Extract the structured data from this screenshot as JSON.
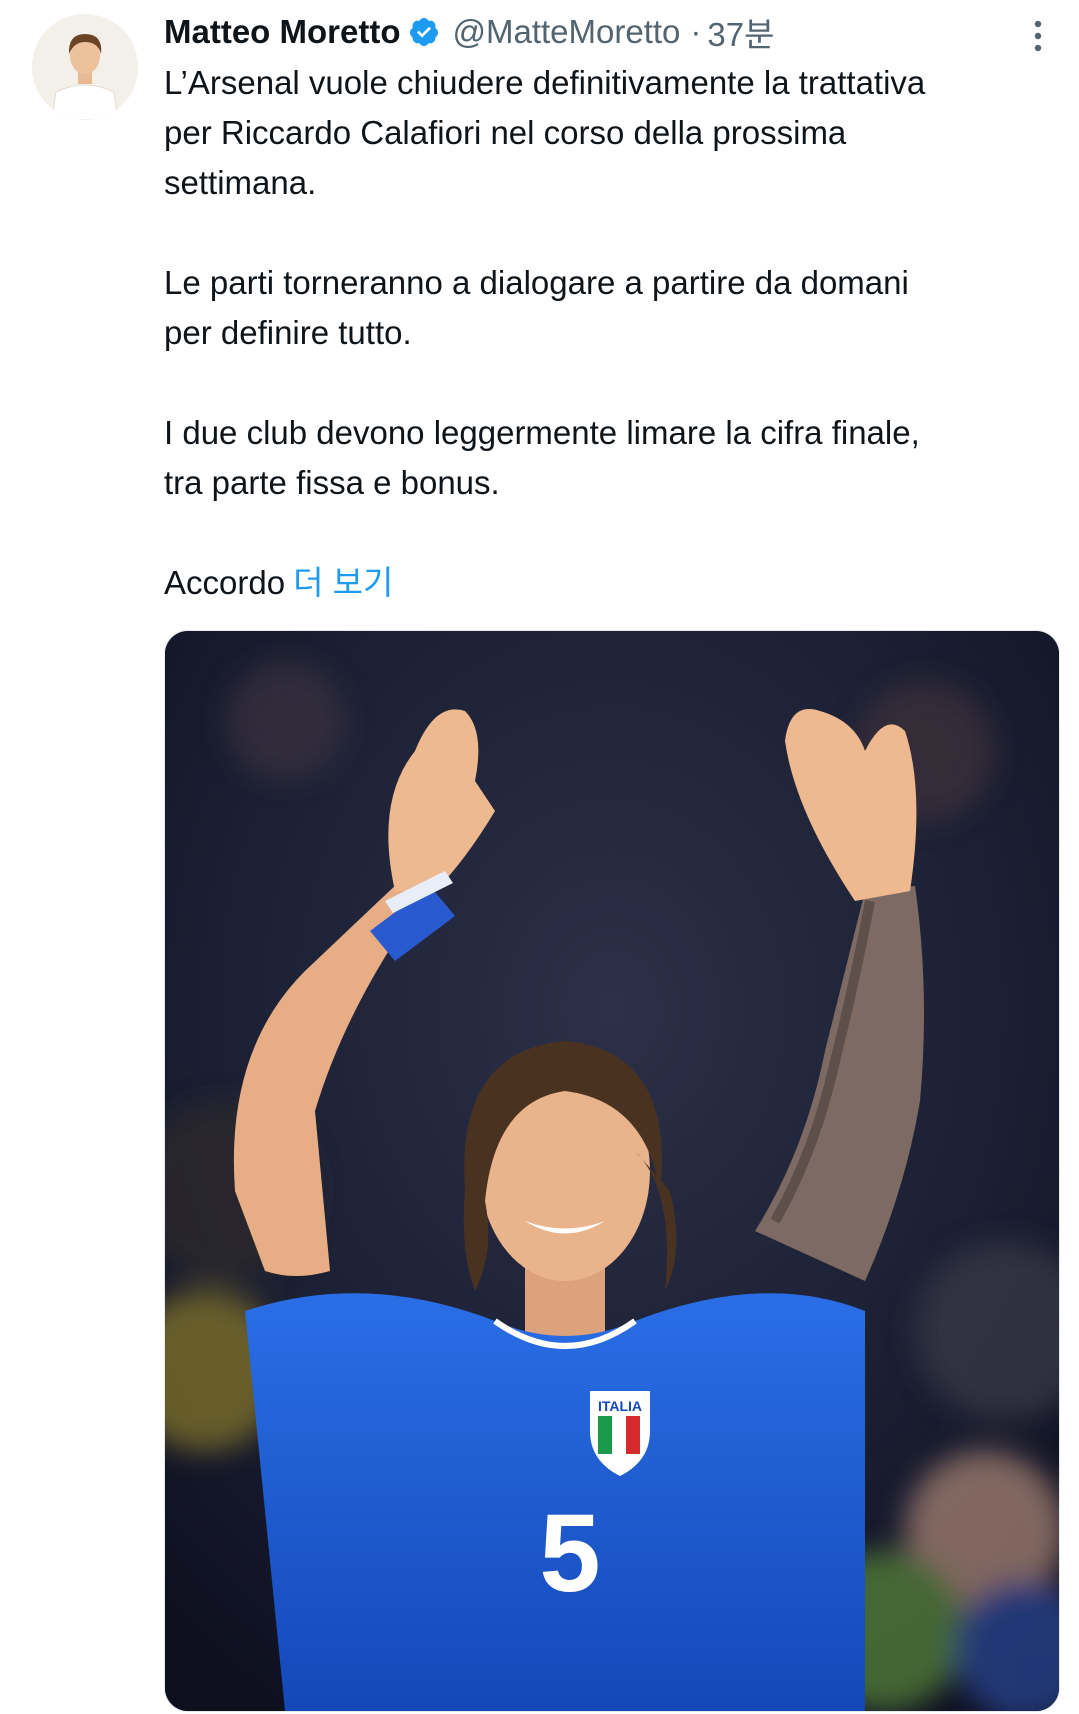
{
  "tweet": {
    "author": {
      "display_name": "Matteo Moretto",
      "handle": "@MatteMoretto",
      "verified": true
    },
    "separator": "·",
    "time": "37분",
    "paragraphs": [
      "L’Arsenal vuole chiudere definitivamente la trattativa\nper Riccardo Calafiori nel corso della prossima\nsettimana.",
      "Le parti torneranno a dialogare a partire da domani\nper definire tutto.",
      "I due club devono leggermente limare la cifra finale,\ntra parte fissa e bonus."
    ],
    "truncated_text": "Accordo",
    "see_more_label": "더 보기",
    "media": {
      "alt": "",
      "jersey_number": "5",
      "crest_text": "ITALIA"
    }
  },
  "colors": {
    "text_primary": "#0f1419",
    "text_secondary": "#536471",
    "link": "#1d9bf0",
    "verified": "#1d9bf0",
    "jersey": "#1f5fd6"
  },
  "icons": {
    "verified": "verified-badge-icon",
    "more": "more-options-icon"
  }
}
